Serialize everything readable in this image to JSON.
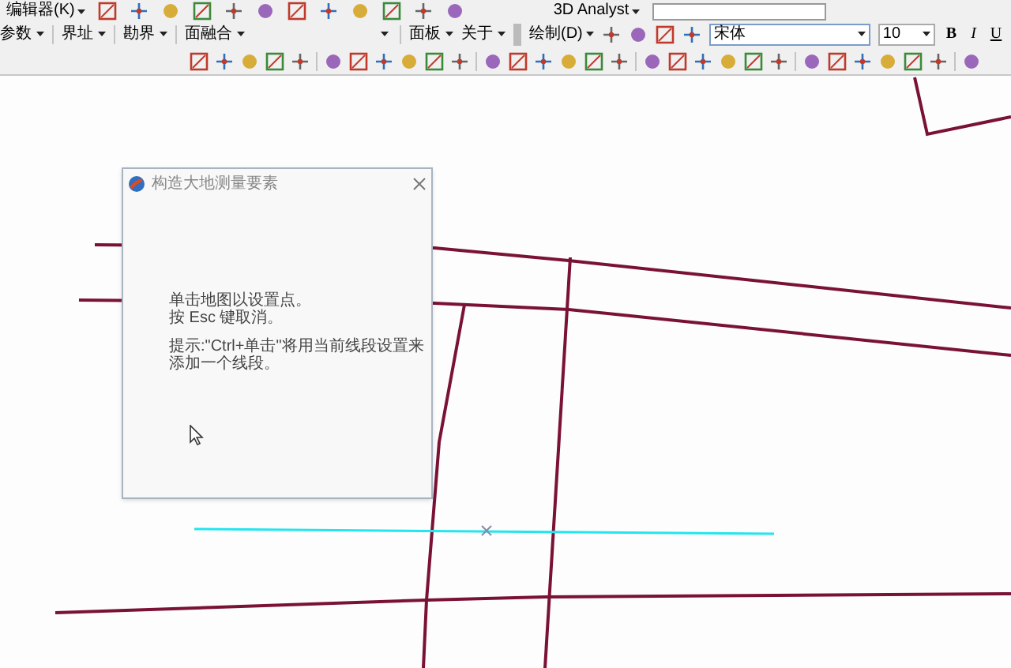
{
  "toolbars": {
    "editor_menu": "编辑器(K)",
    "analyst_menu": "3D Analyst",
    "menus": [
      "参数",
      "界址",
      "勘界",
      "面融合"
    ],
    "menus_right": [
      "面板",
      "关于"
    ],
    "draw_menu": "绘制(D)",
    "font_box": {
      "value": "宋体"
    },
    "size_box": {
      "value": "10"
    },
    "format_buttons": [
      "B",
      "I",
      "U"
    ]
  },
  "dialog": {
    "title": "构造大地测量要素",
    "lines": [
      "单击地图以设置点。",
      "按 Esc 键取消。"
    ],
    "hint": "提示:\"Ctrl+单击\"将用当前线段设置来添加一个线段。"
  }
}
